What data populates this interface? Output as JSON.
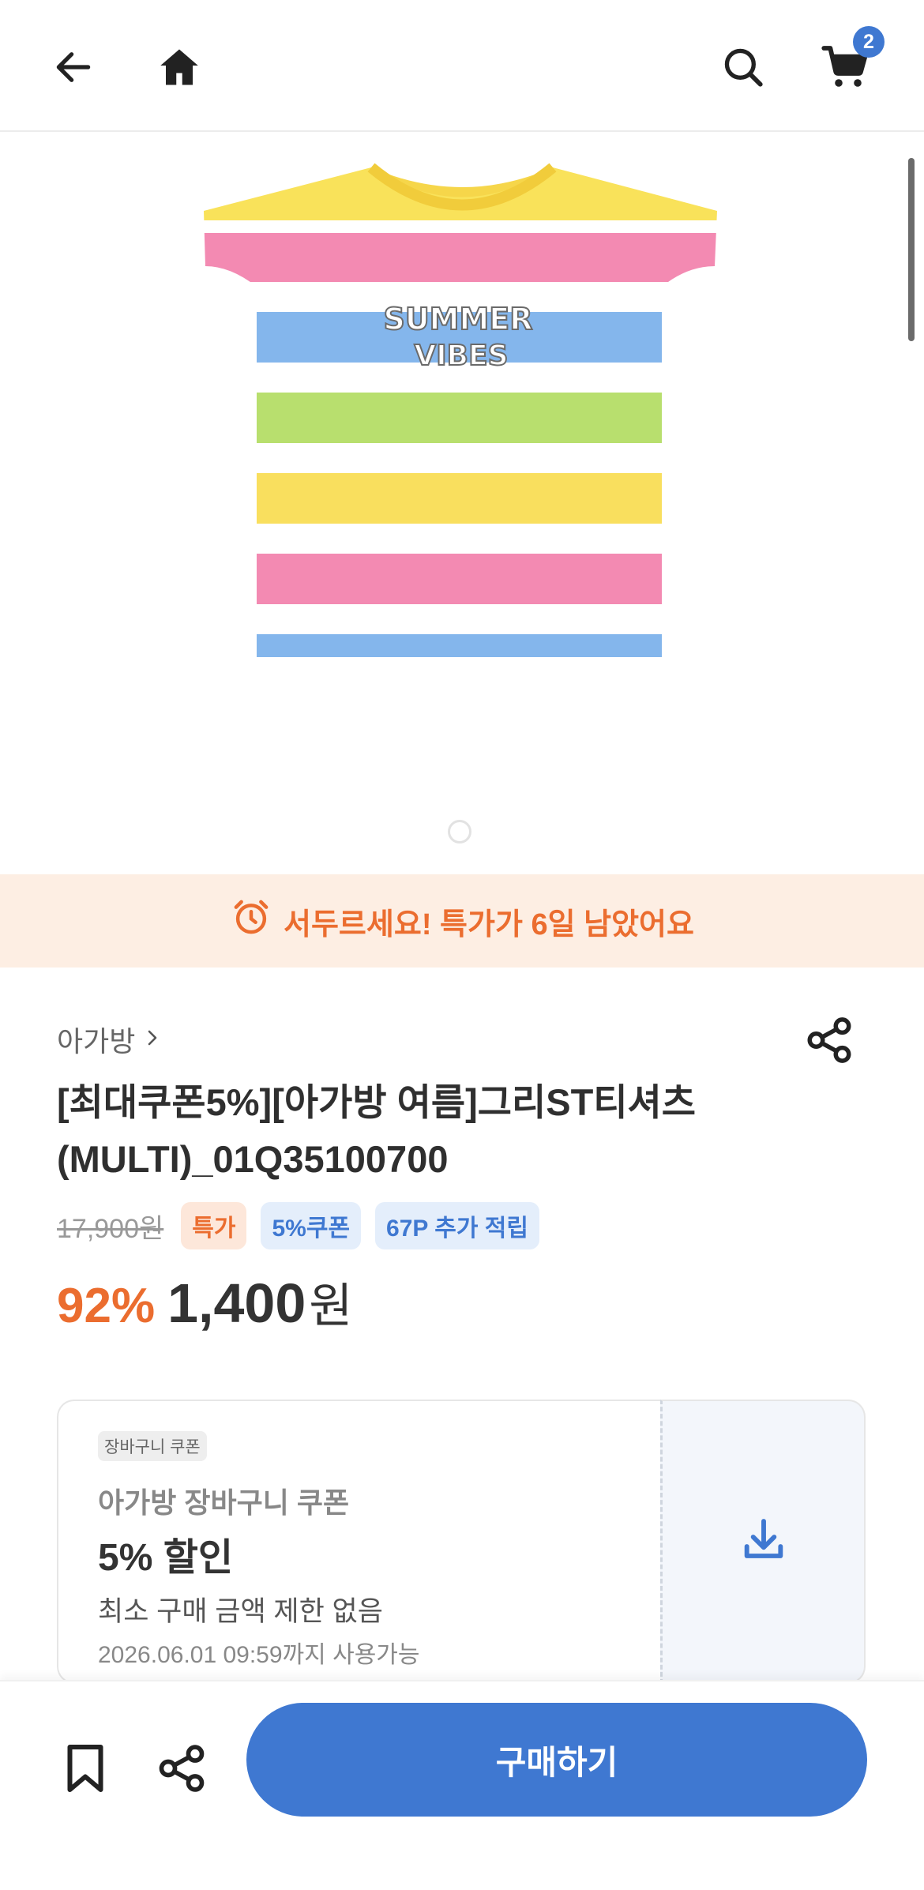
{
  "header": {
    "cart_count": "2"
  },
  "urgency": {
    "text": "서두르세요! 특가가 6일 남았어요"
  },
  "product": {
    "brand": "아가방",
    "title_line1": "[최대쿠폰5%][아가방 여름]그리ST티셔츠",
    "title_line2": "(MULTI)_01Q35100700",
    "original_price": "17,900원",
    "tags": [
      "특가",
      "5%쿠폰",
      "67P 추가 적립"
    ],
    "discount_rate": "92%",
    "sale_amount": "1,400",
    "currency": "원",
    "image_text": [
      "SUMMER",
      "VIBES"
    ]
  },
  "coupon": {
    "badge": "장바구니 쿠폰",
    "name": "아가방 장바구니 쿠폰",
    "discount": "5% 할인",
    "condition": "최소 구매 금액 제한 없음",
    "valid_until": "2026.06.01 09:59까지 사용가능"
  },
  "bottom": {
    "buy_label": "구매하기"
  },
  "colors": {
    "accent": "#3f78d1",
    "orange": "#eb6d2f",
    "urgency_bg": "#fdeee3"
  }
}
